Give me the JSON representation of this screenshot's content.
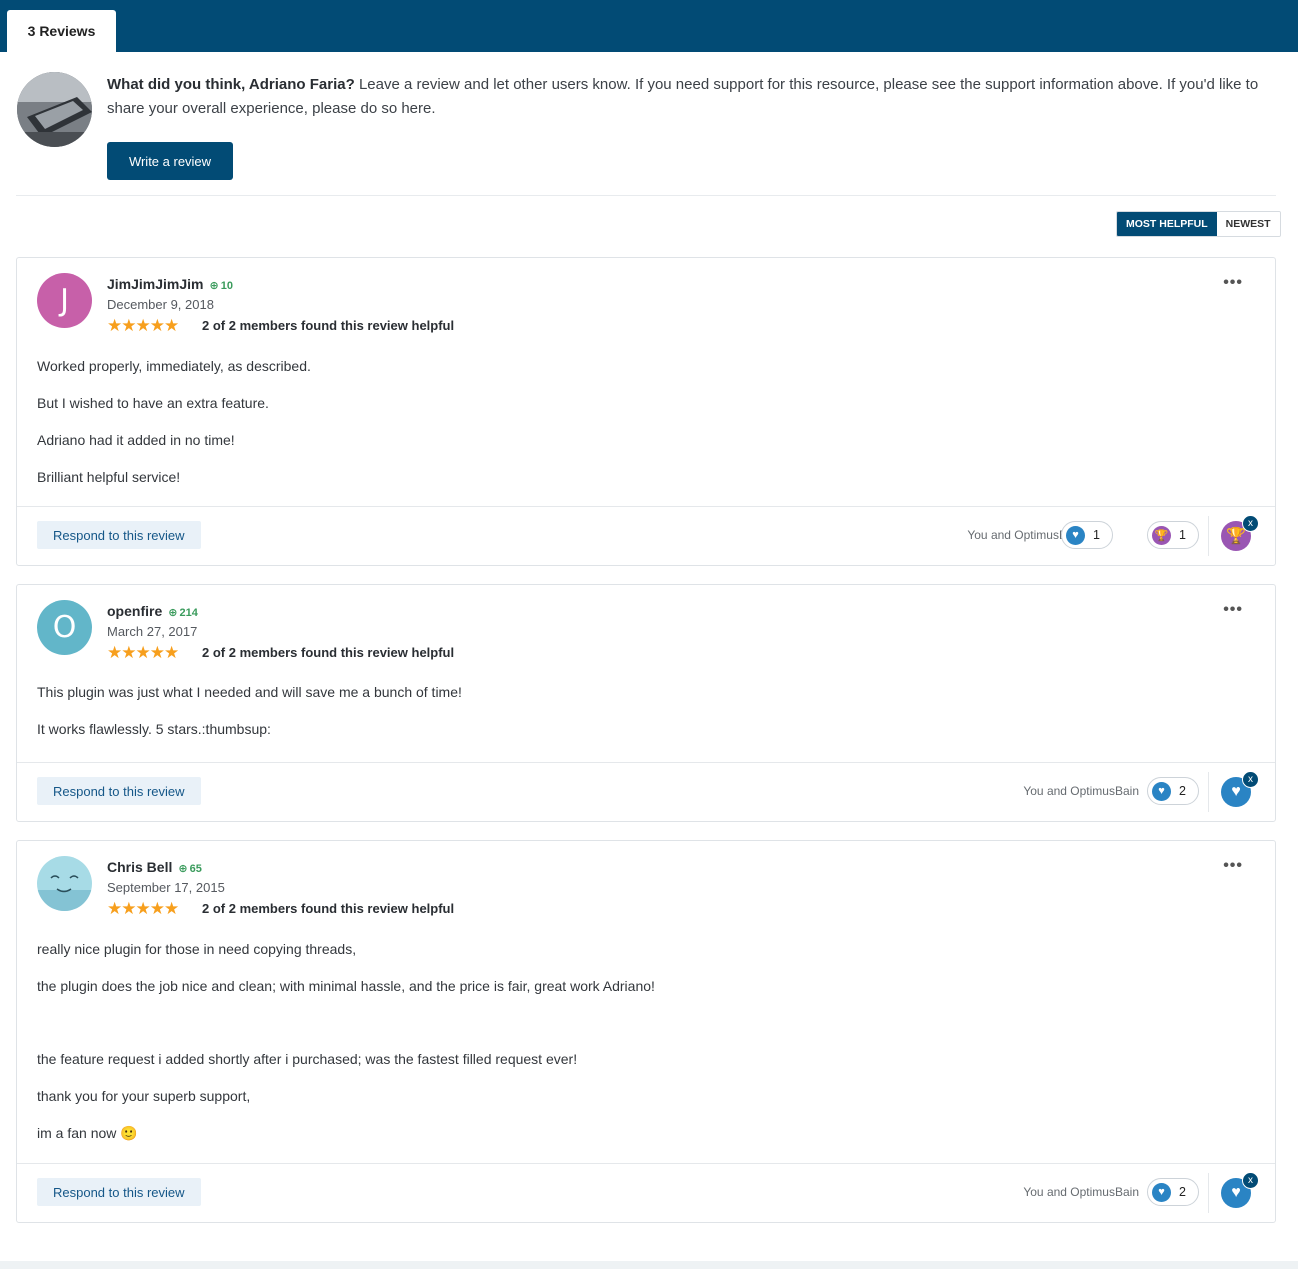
{
  "tab": {
    "label": "3 Reviews"
  },
  "prompt": {
    "bold": "What did you think, Adriano Faria?",
    "text": "Leave a review and let other users know. If you need support for this resource, please see the support information above. If you'd like to share your overall experience, please do so here.",
    "button": "Write a review"
  },
  "sort": {
    "options": [
      "Most Helpful",
      "Newest"
    ],
    "selected": "Most Helpful"
  },
  "reviews": [
    {
      "initial": "J",
      "avatar_color": "#c760a9",
      "name": "JimJimJimJim",
      "rep": "10",
      "date": "December 9, 2018",
      "rating": 5,
      "stars": "★★★★★",
      "helpful": "2 of 2 members found this review helpful",
      "body": [
        "Worked properly, immediately, as described.",
        "But I wished to have an extra feature.",
        "Adriano had it added in no time!",
        "Brilliant helpful service!"
      ],
      "respond": "Respond to this review",
      "reacted_by": "You and OptimusBain",
      "reactions": [
        {
          "icon": "heart-icon",
          "count": "1"
        },
        {
          "icon": "trophy-icon",
          "count": "1"
        }
      ],
      "my_reaction": "trophy-icon"
    },
    {
      "initial": "O",
      "avatar_color": "#62b6c9",
      "name": "openfire",
      "rep": "214",
      "date": "March 27, 2017",
      "rating": 5,
      "stars": "★★★★★",
      "helpful": "2 of 2 members found this review helpful",
      "body": [
        "This plugin was just what I needed and will save me a bunch of time!",
        "It works flawlessly. 5 stars.:thumbsup:"
      ],
      "respond": "Respond to this review",
      "reacted_by": "You and OptimusBain",
      "reactions": [
        {
          "icon": "heart-icon",
          "count": "2"
        }
      ],
      "my_reaction": "heart-icon"
    },
    {
      "initial": "",
      "avatar_color": "#9fd3df",
      "name": "Chris Bell",
      "rep": "65",
      "date": "September 17, 2015",
      "rating": 5,
      "stars": "★★★★★",
      "helpful": "2 of 2 members found this review helpful",
      "body": [
        "really nice plugin for those in need copying threads,",
        "the plugin does the job nice and clean; with minimal hassle, and the price is fair, great work Adriano!",
        "",
        "the feature request i added shortly after i purchased; was the fastest filled request ever!",
        "thank you for your superb support,",
        "im a fan now 🙂"
      ],
      "respond": "Respond to this review",
      "reacted_by": "You and OptimusBain",
      "reactions": [
        {
          "icon": "heart-icon",
          "count": "2"
        }
      ],
      "my_reaction": "heart-icon"
    }
  ]
}
